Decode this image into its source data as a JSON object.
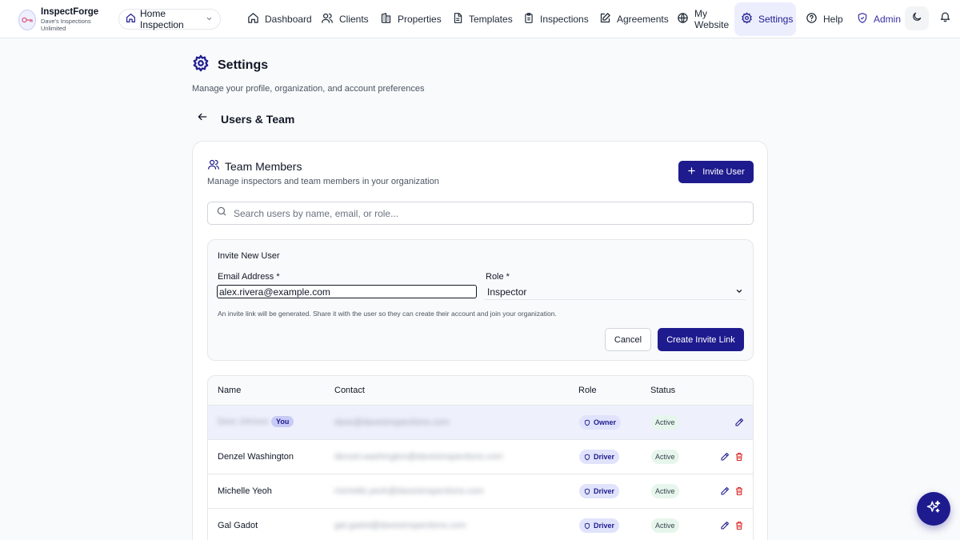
{
  "brand": {
    "name": "InspectForge",
    "org": "Dave's Inspections Unlimited"
  },
  "workspace": {
    "label": "Home Inspection"
  },
  "nav": {
    "dashboard": "Dashboard",
    "clients": "Clients",
    "properties": "Properties",
    "templates": "Templates",
    "inspections": "Inspections",
    "agreements": "Agreements",
    "website_line1": "My",
    "website_line2": "Website",
    "settings": "Settings",
    "help": "Help",
    "admin": "Admin"
  },
  "page": {
    "title": "Settings",
    "subtitle": "Manage your profile, organization, and account preferences",
    "section": "Users & Team"
  },
  "team": {
    "title": "Team Members",
    "subtitle": "Manage inspectors and team members in your organization",
    "invite_label": "Invite User",
    "search_placeholder": "Search users by name, email, or role..."
  },
  "invite_form": {
    "title": "Invite New User",
    "email_label": "Email Address *",
    "email_value": "alex.rivera@example.com",
    "role_label": "Role *",
    "role_value": "Inspector",
    "hint": "An invite link will be generated. Share it with the user so they can create their account and join your organization.",
    "cancel": "Cancel",
    "create": "Create Invite Link"
  },
  "table": {
    "headers": {
      "name": "Name",
      "contact": "Contact",
      "role": "Role",
      "status": "Status"
    },
    "rows": [
      {
        "name": "Dave Johnson",
        "you": "You",
        "contact": "dave@davesinspections.com",
        "role": "Owner",
        "status": "Active"
      },
      {
        "name": "Denzel Washington",
        "contact": "denzel.washington@davesinspections.com",
        "role": "Driver",
        "status": "Active"
      },
      {
        "name": "Michelle Yeoh",
        "contact": "michelle.yeoh@davesinspections.com",
        "role": "Driver",
        "status": "Active"
      },
      {
        "name": "Gal Gadot",
        "contact": "gal.gadot@davesinspections.com",
        "role": "Driver",
        "status": "Active"
      }
    ]
  },
  "colors": {
    "accent": "#1e1b8f",
    "active_nav_bg": "#eceefe",
    "status_bg": "#e7f6ec",
    "danger": "#dc2626"
  },
  "icons": [
    "logo-icon",
    "home-icon",
    "chevron-down-icon",
    "dashboard-icon",
    "users-icon",
    "building-icon",
    "document-icon",
    "clipboard-icon",
    "pen-icon",
    "globe-icon",
    "gear-icon",
    "help-icon",
    "shield-icon",
    "moon-icon",
    "bell-icon",
    "arrow-left-icon",
    "plus-icon",
    "search-icon",
    "edit-icon",
    "trash-icon",
    "sparkles-icon"
  ]
}
